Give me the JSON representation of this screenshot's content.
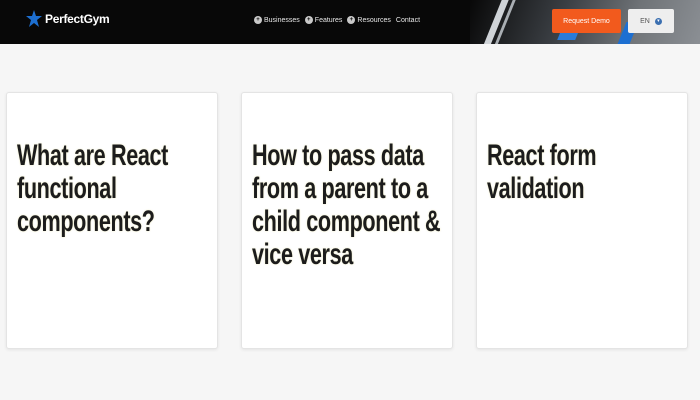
{
  "header": {
    "logo_text": "PerfectGym",
    "nav_items": [
      {
        "label": "Businesses",
        "icon": "plus-circle-icon"
      },
      {
        "label": "Features",
        "icon": "plus-circle-icon"
      },
      {
        "label": "Resources",
        "icon": "plus-circle-icon"
      },
      {
        "label": "Contact",
        "icon": ""
      }
    ],
    "cta_label": "Request Demo",
    "language": "EN"
  },
  "cards": [
    {
      "title": "What are React functional components?"
    },
    {
      "title": "How to pass data from a parent to a child component & vice versa"
    },
    {
      "title": "React form validation"
    }
  ],
  "colors": {
    "navbar_bg": "#080808",
    "accent_orange": "#f25a1d",
    "logo_blue": "#1d6fd1",
    "page_bg": "#f6f6f6",
    "card_bg": "#ffffff"
  }
}
